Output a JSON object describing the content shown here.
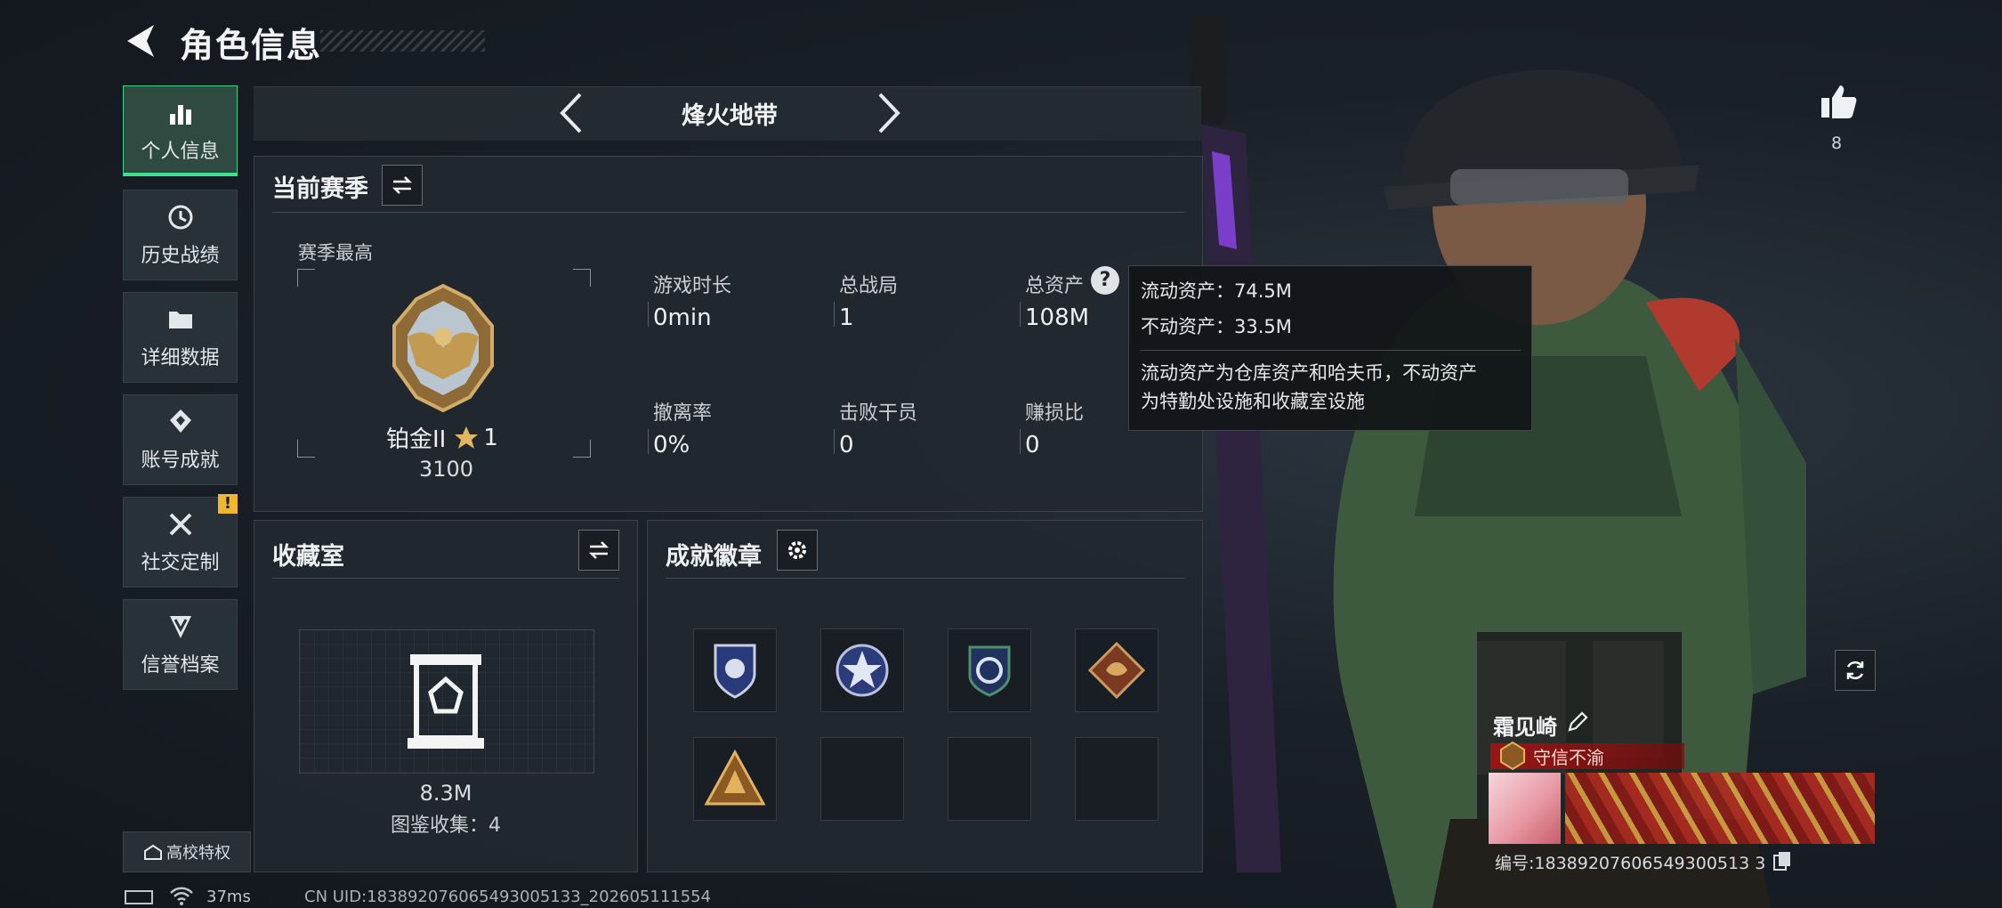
{
  "header": {
    "title": "角色信息"
  },
  "sidebar": {
    "items": [
      {
        "label": "个人信息",
        "icon": "bar-chart-icon",
        "active": true
      },
      {
        "label": "历史战绩",
        "icon": "history-clock-icon",
        "active": false
      },
      {
        "label": "详细数据",
        "icon": "folder-icon",
        "active": false
      },
      {
        "label": "账号成就",
        "icon": "diamond-medal-icon",
        "active": false
      },
      {
        "label": "社交定制",
        "icon": "tools-icon",
        "active": false,
        "badge": "!"
      },
      {
        "label": "信誉档案",
        "icon": "shield-chevron-icon",
        "active": false
      }
    ],
    "campus_label": "高校特权"
  },
  "mode": {
    "label": "烽火地带"
  },
  "season": {
    "title": "当前赛季",
    "best_label": "赛季最高",
    "rank_name": "铂金II",
    "rank_stars": "1",
    "rank_score": "3100",
    "stats": [
      {
        "label": "游戏时长",
        "value": "0min"
      },
      {
        "label": "总战局",
        "value": "1"
      },
      {
        "label": "总资产",
        "value": "108M"
      },
      {
        "label": "撤离率",
        "value": "0%"
      },
      {
        "label": "击败干员",
        "value": "0"
      },
      {
        "label": "赚损比",
        "value": "0"
      }
    ],
    "help_glyph": "?"
  },
  "tooltip": {
    "liquid": "流动资产：74.5M",
    "fixed": "不动资产：33.5M",
    "desc_line1": "流动资产为仓库资产和哈夫币，不动资产",
    "desc_line2": "为特勤处设施和收藏室设施"
  },
  "collection": {
    "title": "收藏室",
    "value": "8.3M",
    "collected": "图鉴收集：4"
  },
  "achievements": {
    "title": "成就徽章",
    "badges": [
      "police-badge-icon",
      "star-badge-icon",
      "cycle-badge-icon",
      "dragon-badge-icon",
      "triangle-badge-icon",
      "",
      "",
      ""
    ]
  },
  "profile": {
    "likes": "8",
    "name": "霜见崎",
    "title": "守信不渝",
    "id": "编号:18389207606549300513 3"
  },
  "status": {
    "ping": "37ms",
    "uid": "CN UID:183892076065493005133_202605111554"
  },
  "colors": {
    "accent": "#3fe08f",
    "warning": "#f0b830",
    "title_red": "#a01414"
  }
}
